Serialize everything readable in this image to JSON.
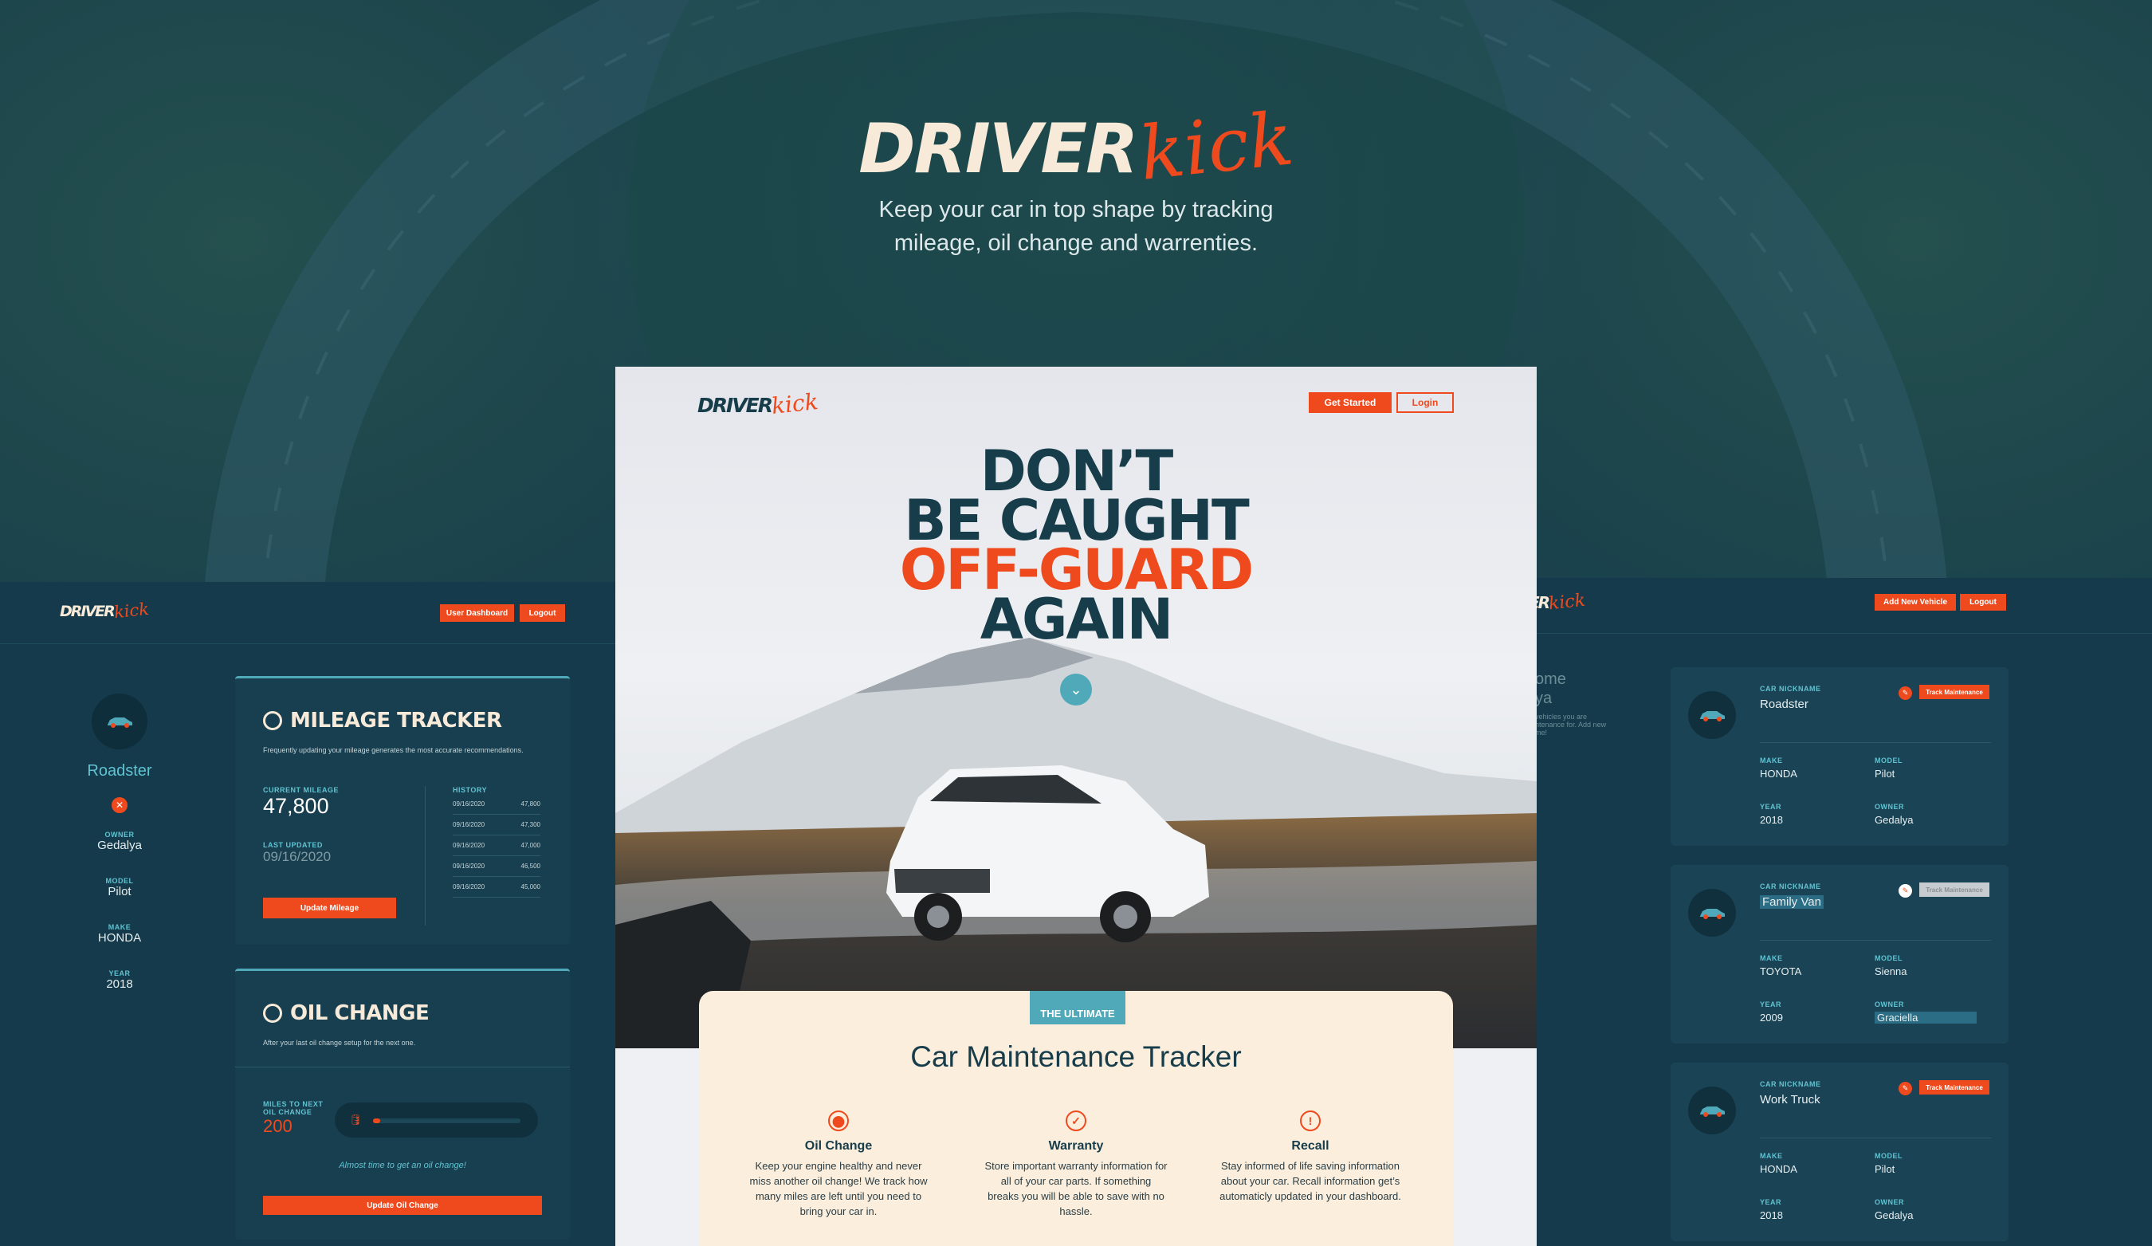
{
  "hero": {
    "logo_bold": "DRIVER",
    "logo_script": "kick",
    "tagline_line1": "Keep your car in top shape by tracking",
    "tagline_line2": "mileage, oil change and warrenties."
  },
  "colors": {
    "accent": "#ef4a1e",
    "teal": "#4fa9b8",
    "navy": "#173d4b",
    "cream": "#fbeedc"
  },
  "dashboard": {
    "logo_bold": "DRIVER",
    "logo_script": "kick",
    "user_dashboard_label": "User Dashboard",
    "logout_label": "Logout",
    "vehicle": {
      "nickname": "Roadster",
      "owner_label": "OWNER",
      "owner": "Gedalya",
      "model_label": "MODEL",
      "model": "Pilot",
      "make_label": "MAKE",
      "make": "HONDA",
      "year_label": "YEAR",
      "year": "2018"
    },
    "mileage": {
      "title": "MILEAGE TRACKER",
      "description": "Frequently updating your mileage generates the most accurate recommendations.",
      "current_label": "CURRENT MILEAGE",
      "current_value": "47,800",
      "last_updated_label": "LAST UPDATED",
      "last_updated_value": "09/16/2020",
      "update_button": "Update Mileage",
      "history_label": "HISTORY",
      "history": [
        {
          "date": "09/16/2020",
          "miles": "47,800"
        },
        {
          "date": "09/16/2020",
          "miles": "47,300"
        },
        {
          "date": "09/16/2020",
          "miles": "47,000"
        },
        {
          "date": "09/16/2020",
          "miles": "46,500"
        },
        {
          "date": "09/16/2020",
          "miles": "45,000"
        }
      ]
    },
    "oil": {
      "title": "OIL CHANGE",
      "description": "After your last oil change setup for the next one.",
      "miles_label_line1": "MILES TO NEXT",
      "miles_label_line2": "OIL CHANGE",
      "miles_value": "200",
      "progress_fraction": 0.05,
      "message": "Almost time to get an oil change!",
      "update_button": "Update Oil Change"
    }
  },
  "landing": {
    "logo_bold": "DRIVER",
    "logo_script": "kick",
    "get_started": "Get Started",
    "login": "Login",
    "headline_line1": "DON’T",
    "headline_line2": "BE CAUGHT",
    "headline_line3": "OFF-GUARD",
    "headline_line4": "AGAIN",
    "badge": "THE ULTIMATE",
    "section_title": "Car Maintenance Tracker",
    "features": [
      {
        "icon": "oil-can-icon",
        "title": "Oil Change",
        "text": "Keep your engine healthy and never miss another oil change! We track how many miles are left until you need to bring your car in."
      },
      {
        "icon": "check-circle-icon",
        "title": "Warranty",
        "text": "Store important warranty information for all of your car parts. If something breaks you will be able to save with no hassle."
      },
      {
        "icon": "alert-circle-icon",
        "title": "Recall",
        "text": "Stay informed of life saving information about your car. Recall information get’s automaticly updated in your dashboard."
      }
    ]
  },
  "vehicles": {
    "logo_partial": "ER",
    "logo_script": "kick",
    "add_vehicle_label": "Add New Vehicle",
    "logout_label": "Logout",
    "intro_heading_line1": "ome",
    "intro_heading_line2": "ya",
    "intro_text_line1": "vehicles you are",
    "intro_text_line2": "ntenance for. Add new",
    "intro_text_line3": "me!",
    "nickname_label": "CAR NICKNAME",
    "make_label": "MAKE",
    "model_label": "MODEL",
    "year_label": "YEAR",
    "owner_label": "OWNER",
    "track_label": "Track Maintenance",
    "cards": [
      {
        "nickname": "Roadster",
        "make": "HONDA",
        "model": "Pilot",
        "year": "2018",
        "owner": "Gedalya"
      },
      {
        "nickname": "Family Van",
        "make": "TOYOTA",
        "model": "Sienna",
        "year": "2009",
        "owner": "Graciella"
      },
      {
        "nickname": "Work Truck",
        "make": "HONDA",
        "model": "Pilot",
        "year": "2018",
        "owner": "Gedalya"
      }
    ]
  }
}
